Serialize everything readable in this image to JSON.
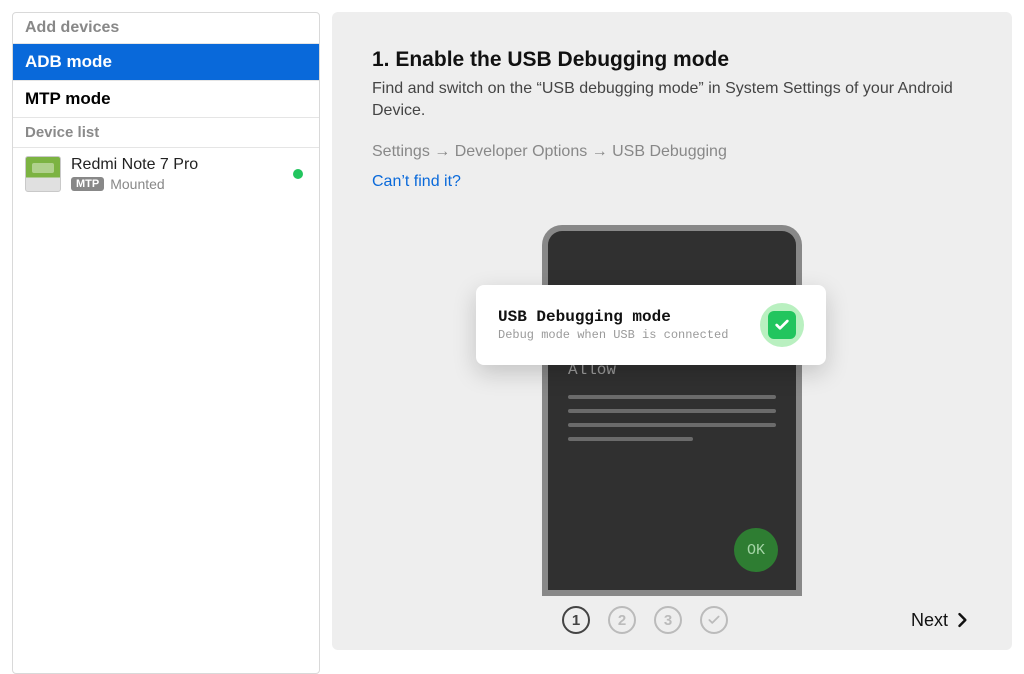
{
  "sidebar": {
    "header": "Add devices",
    "modes": [
      {
        "label": "ADB mode",
        "active": true
      },
      {
        "label": "MTP mode",
        "active": false
      }
    ],
    "device_list_header": "Device list",
    "devices": [
      {
        "name": "Redmi Note 7 Pro",
        "badge": "MTP",
        "status": "Mounted",
        "status_color": "#22c55e"
      }
    ]
  },
  "main": {
    "step_title": "1. Enable the USB Debugging mode",
    "step_desc": "Find and switch on the “USB debugging mode” in System Settings of your Android Device.",
    "step_path": "Settings → Developer Options → USB Debugging",
    "help_link": "Can’t find it?",
    "usb_card": {
      "title": "USB Debugging mode",
      "subtitle": "Debug mode when USB is connected"
    },
    "phone": {
      "allow_text": "Allow",
      "ok_label": "OK"
    }
  },
  "footer": {
    "steps": [
      "1",
      "2",
      "3",
      "✓"
    ],
    "active_step": 0,
    "next_label": "Next"
  }
}
